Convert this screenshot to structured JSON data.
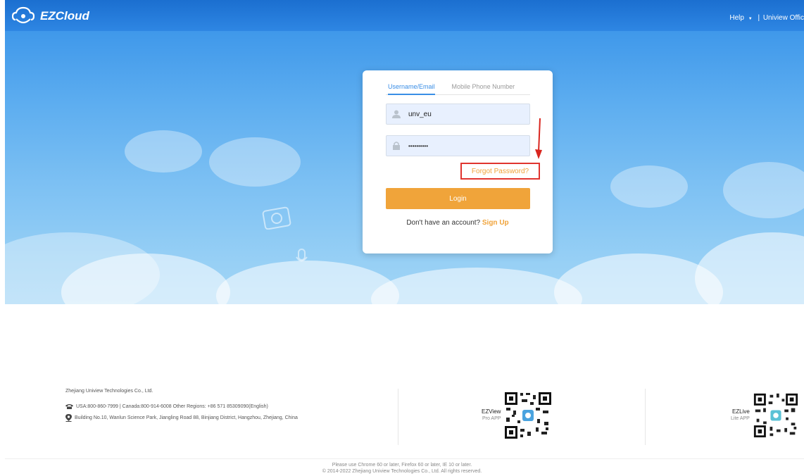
{
  "brand": {
    "name": "EZCloud"
  },
  "topnav": {
    "help": "Help",
    "caret": "▼",
    "separator": "|",
    "office": "Uniview Offic"
  },
  "login": {
    "tabs": [
      {
        "label": "Username/Email",
        "active": true
      },
      {
        "label": "Mobile Phone Number",
        "active": false
      }
    ],
    "username": {
      "value": "unv_eu",
      "icon": "user-icon"
    },
    "password": {
      "value": "••••••••••",
      "icon": "lock-icon"
    },
    "forgot_label": "Forgot Password?",
    "login_label": "Login",
    "signup_prompt": "Don't have an account?",
    "signup_label": "Sign Up"
  },
  "footer": {
    "company": "Zhejiang Uniview Technologies Co., Ltd.",
    "phone": "USA:800-860-7999 | Canada:800-914-6008 Other Regions: +86 571 85309090(English)",
    "address": "Building No.10, Wanlun Science Park, Jiangling Road 88, Binjiang District, Hangzhou, Zhejiang, China",
    "apps": [
      {
        "name": "EZView",
        "sub": "Pro APP"
      },
      {
        "name": "EZLive",
        "sub": "Lite APP"
      }
    ],
    "browser_note": "Please use Chrome 60 or later, Firefox 60 or later, IE 10 or later.",
    "copyright": "© 2014-2022 Zhejiang Uniview Technologies Co., Ltd. All rights reserved."
  },
  "colors": {
    "accent": "#3a8ee6",
    "orange": "#f0a43a",
    "highlight": "#e0342f"
  }
}
